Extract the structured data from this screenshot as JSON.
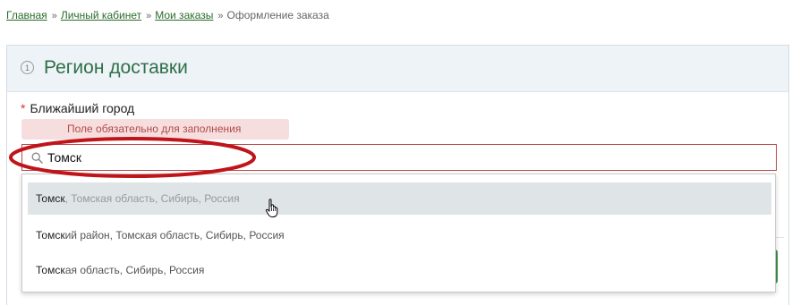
{
  "breadcrumb": {
    "items": [
      "Главная",
      "Личный кабинет",
      "Мои заказы"
    ],
    "current": "Оформление заказа",
    "separator": "»"
  },
  "section": {
    "step": "1",
    "title": "Регион доставки"
  },
  "city_field": {
    "required_mark": "*",
    "label": "Ближайший город",
    "error": "Поле обязательно для заполнения",
    "value": "Томск"
  },
  "suggestions": [
    {
      "match": "Томск",
      "rest": ", Томская область, Сибирь, Россия",
      "highlighted": true
    },
    {
      "match": "Томск",
      "rest": "ий район, Томская область, Сибирь, Россия",
      "highlighted": false
    },
    {
      "match": "Томск",
      "rest": "ая область, Сибирь, Россия",
      "highlighted": false
    }
  ],
  "colors": {
    "accent": "#2f6f47",
    "error": "#b84848",
    "annotation": "#c0141b"
  }
}
